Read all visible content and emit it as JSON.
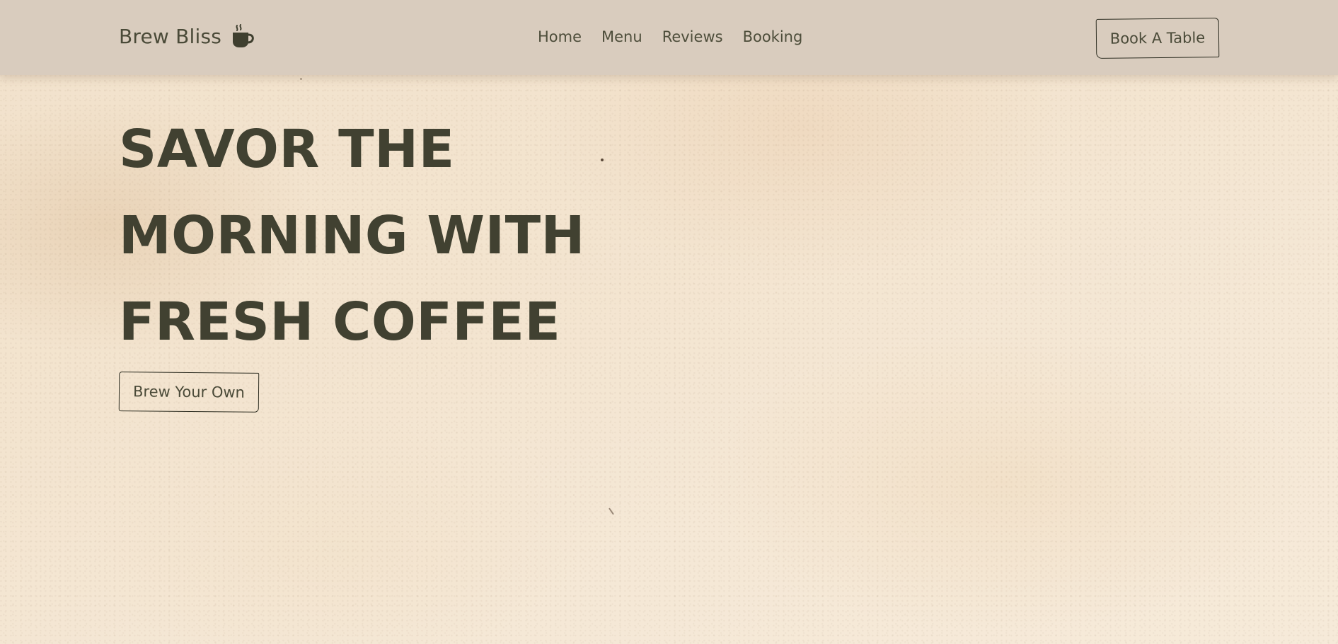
{
  "header": {
    "brand_name": "Brew Bliss",
    "brand_icon": "coffee-cup-icon",
    "nav": [
      {
        "label": "Home"
      },
      {
        "label": "Menu"
      },
      {
        "label": "Reviews"
      },
      {
        "label": "Booking"
      }
    ],
    "cta_label": "Book A Table"
  },
  "hero": {
    "title_lines": [
      "SAVOR THE",
      "MORNING WITH",
      "FRESH COFFEE"
    ],
    "button_label": "Brew Your Own"
  },
  "colors": {
    "header_bg": "#d9ccbe",
    "page_bg": "#f3e4cf",
    "text_dark": "#414131",
    "border": "#2e2e22"
  }
}
